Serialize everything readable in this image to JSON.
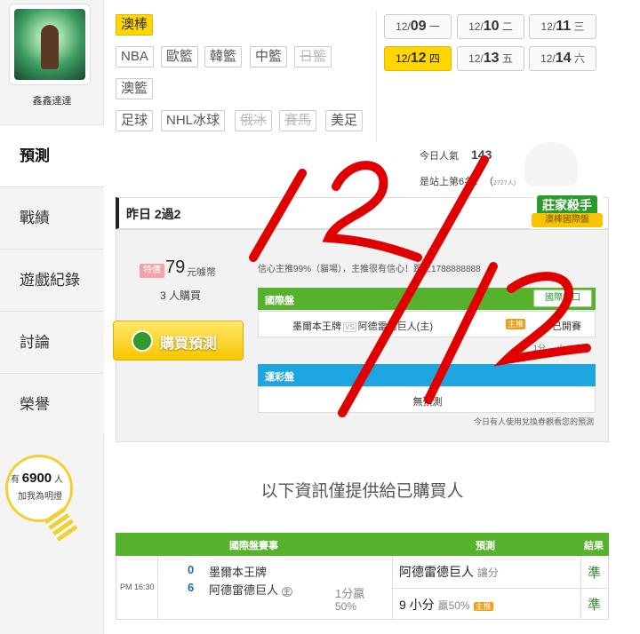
{
  "sidebar": {
    "username": "鑫鑫達達",
    "nav": [
      "預測",
      "戰績",
      "遊戲紀錄",
      "討論",
      "榮譽"
    ],
    "bulb": {
      "prefix": "有",
      "count": "6900",
      "suffix": "人",
      "line2": "加我為明燈"
    }
  },
  "tags": [
    "澳棒",
    "NBA",
    "歐籃",
    "韓籃",
    "中籃",
    "日籃",
    "澳籃",
    "足球",
    "NHL冰球",
    "俄冰",
    "賽馬",
    "美足"
  ],
  "dates": [
    {
      "m": "12/",
      "d": "09",
      "w": "一"
    },
    {
      "m": "12/",
      "d": "10",
      "w": "二"
    },
    {
      "m": "12/",
      "d": "11",
      "w": "三"
    },
    {
      "m": "12/",
      "d": "12",
      "w": "四"
    },
    {
      "m": "12/",
      "d": "13",
      "w": "五"
    },
    {
      "m": "12/",
      "d": "14",
      "w": "六"
    }
  ],
  "stats": {
    "popularity_label": "今日人氣",
    "popularity_value": "143",
    "rank_text": "是站上第6名！（",
    "rank_tail": "2727人)"
  },
  "badge": {
    "title": "莊家殺手",
    "subtitle": "澳棒國際盤"
  },
  "panel": {
    "header": "昨日 2過2",
    "price_tag": "特價",
    "price": "79",
    "price_unit": "元噱幣",
    "buyers": "3 人購買",
    "buy_button": "購買預測",
    "remark": "信心主推99%（貓場），主推很有信心！跟上1788888888",
    "intl_title": "國際盤",
    "intl_button": "國際盤口",
    "match_home": "墨爾本王牌",
    "vs": "VS",
    "match_away": "阿德雷德巨人(主)",
    "zt": "主推",
    "result": "已開賽",
    "intl_sub": "1分 ... 小",
    "lottery_title": "運彩盤",
    "lottery_empty": "無預測",
    "voucher": "今日有人使用兌換券觀看您的預測"
  },
  "info_title": "以下資訊僅提供給已購買人",
  "results": {
    "headers": [
      "國際盤賽事",
      "預測",
      "結果"
    ],
    "time": "PM 16:30",
    "team1": {
      "score": "0",
      "name": "墨爾本王牌"
    },
    "team2": {
      "score": "6",
      "name": "阿德雷德巨人",
      "host": "主"
    },
    "line1": "1分贏",
    "line2": "50%",
    "pred1": {
      "text": "阿德雷德巨人",
      "note": "讓分",
      "mark": "準"
    },
    "pred2": {
      "text": "9 小分",
      "note": "贏50%",
      "zt": "主推",
      "mark": "準"
    }
  },
  "handwriting": "12/12"
}
